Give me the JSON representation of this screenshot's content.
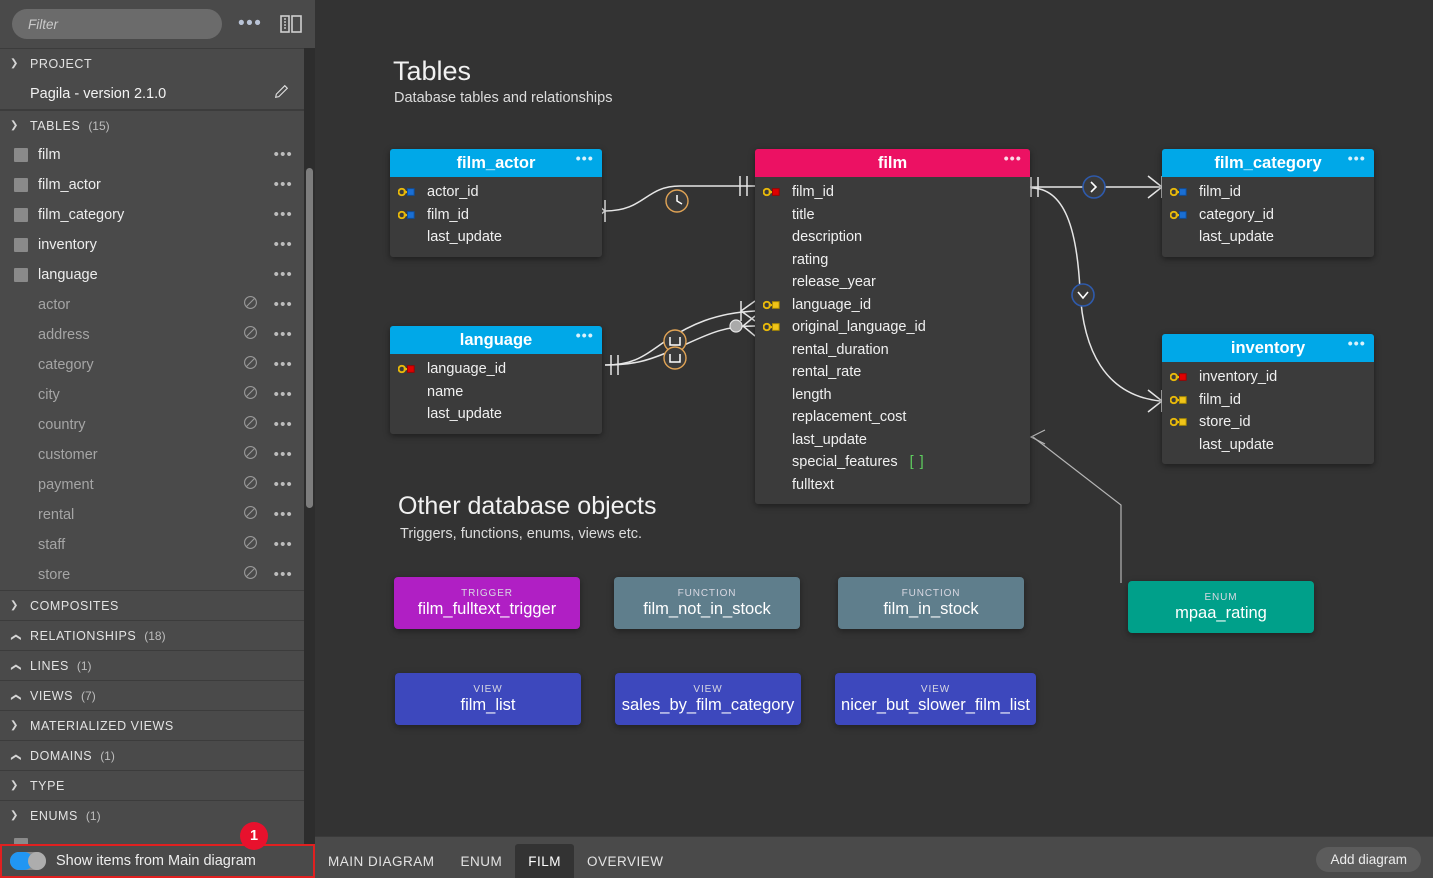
{
  "sidebar": {
    "filter_placeholder": "Filter",
    "more_icon": "more-horizontal-icon",
    "panel_toggle_icon": "panel-layout-icon",
    "sections": {
      "project": {
        "label": "PROJECT",
        "expanded": true,
        "name": "Pagila - version 2.1.0",
        "edit_icon": "pencil-icon"
      },
      "tables": {
        "label": "TABLES",
        "count": "(15)",
        "expanded": true
      },
      "composites": {
        "label": "COMPOSITES",
        "count": "",
        "expanded": true
      },
      "relationships": {
        "label": "RELATIONSHIPS",
        "count": "(18)",
        "expanded": false
      },
      "lines": {
        "label": "LINES",
        "count": "(1)",
        "expanded": false
      },
      "views": {
        "label": "VIEWS",
        "count": "(7)",
        "expanded": false
      },
      "materialized_views": {
        "label": "MATERIALIZED VIEWS",
        "count": "",
        "expanded": true
      },
      "domains": {
        "label": "DOMAINS",
        "count": "(1)",
        "expanded": false
      },
      "type": {
        "label": "TYPE",
        "count": "",
        "expanded": true
      },
      "enums": {
        "label": "ENUMS",
        "count": "(1)",
        "expanded": true
      }
    },
    "tables_active": [
      {
        "label": "film"
      },
      {
        "label": "film_actor"
      },
      {
        "label": "film_category"
      },
      {
        "label": "inventory"
      },
      {
        "label": "language"
      }
    ],
    "tables_hidden": [
      {
        "label": "actor"
      },
      {
        "label": "address"
      },
      {
        "label": "category"
      },
      {
        "label": "city"
      },
      {
        "label": "country"
      },
      {
        "label": "customer"
      },
      {
        "label": "payment"
      },
      {
        "label": "rental"
      },
      {
        "label": "staff"
      },
      {
        "label": "store"
      }
    ],
    "footer": {
      "toggle_label": "Show items from Main diagram",
      "toggle_on": true,
      "badge": "1"
    }
  },
  "canvas": {
    "tables_heading": "Tables",
    "tables_subheading": "Database tables and relationships",
    "other_heading": "Other database objects",
    "other_subheading": "Triggers, functions, enums, views etc.",
    "tables": [
      {
        "name": "film_actor",
        "header_color": "#00a8e8",
        "columns": [
          {
            "name": "actor_id",
            "key": "pk-blue"
          },
          {
            "name": "film_id",
            "key": "pk-blue"
          },
          {
            "name": "last_update",
            "key": "none"
          }
        ]
      },
      {
        "name": "film",
        "header_color": "#ec1163",
        "columns": [
          {
            "name": "film_id",
            "key": "pk-red"
          },
          {
            "name": "title",
            "key": "none"
          },
          {
            "name": "description",
            "key": "none"
          },
          {
            "name": "rating",
            "key": "none"
          },
          {
            "name": "release_year",
            "key": "none"
          },
          {
            "name": "language_id",
            "key": "fk-yellow"
          },
          {
            "name": "original_language_id",
            "key": "fk-yellow"
          },
          {
            "name": "rental_duration",
            "key": "none"
          },
          {
            "name": "rental_rate",
            "key": "none"
          },
          {
            "name": "length",
            "key": "none"
          },
          {
            "name": "replacement_cost",
            "key": "none"
          },
          {
            "name": "last_update",
            "key": "none"
          },
          {
            "name": "special_features",
            "key": "none",
            "array": "[ ]"
          },
          {
            "name": "fulltext",
            "key": "none"
          }
        ]
      },
      {
        "name": "film_category",
        "header_color": "#00a8e8",
        "columns": [
          {
            "name": "film_id",
            "key": "pk-blue"
          },
          {
            "name": "category_id",
            "key": "pk-blue"
          },
          {
            "name": "last_update",
            "key": "none"
          }
        ]
      },
      {
        "name": "language",
        "header_color": "#00a8e8",
        "columns": [
          {
            "name": "language_id",
            "key": "pk-red"
          },
          {
            "name": "name",
            "key": "none"
          },
          {
            "name": "last_update",
            "key": "none"
          }
        ]
      },
      {
        "name": "inventory",
        "header_color": "#00a8e8",
        "columns": [
          {
            "name": "inventory_id",
            "key": "pk-red"
          },
          {
            "name": "film_id",
            "key": "fk-yellow"
          },
          {
            "name": "store_id",
            "key": "fk-yellow"
          },
          {
            "name": "last_update",
            "key": "none"
          }
        ]
      }
    ],
    "objects": [
      {
        "kind": "TRIGGER",
        "name": "film_fulltext_trigger",
        "color": "#b01fc4"
      },
      {
        "kind": "FUNCTION",
        "name": "film_not_in_stock",
        "color": "#5f7e8c"
      },
      {
        "kind": "FUNCTION",
        "name": "film_in_stock",
        "color": "#5f7e8c"
      },
      {
        "kind": "ENUM",
        "name": "mpaa_rating",
        "color": "#00a08a"
      },
      {
        "kind": "VIEW",
        "name": "film_list",
        "color": "#3d48bd"
      },
      {
        "kind": "VIEW",
        "name": "sales_by_film_category",
        "color": "#3d48bd"
      },
      {
        "kind": "VIEW",
        "name": "nicer_but_slower_film_list",
        "color": "#3d48bd"
      }
    ]
  },
  "tabbar": {
    "tabs": [
      {
        "label": "MAIN DIAGRAM",
        "active": false
      },
      {
        "label": "ENUM",
        "active": false
      },
      {
        "label": "FILM",
        "active": true
      },
      {
        "label": "OVERVIEW",
        "active": false
      }
    ],
    "add_button": "Add diagram"
  }
}
